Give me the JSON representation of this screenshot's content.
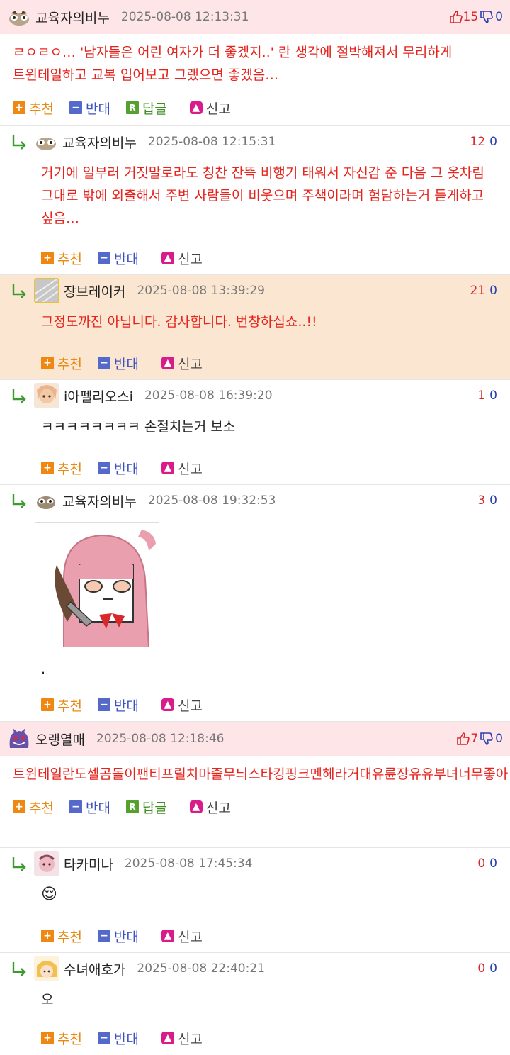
{
  "labels": {
    "recommend": "추천",
    "oppose": "반대",
    "reply": "답글",
    "report": "신고"
  },
  "colors": {
    "highlight_row": "#fbe6d2",
    "top_header": "#fde5e8",
    "up": "#d7262c",
    "down": "#2a3fb0"
  },
  "comments": [
    {
      "nick": "교육자의비누",
      "date": "2025-08-08 12:13:31",
      "up": "15",
      "down": "0",
      "text": "ㄹㅇㄹㅇ… '남자들은 어린 여자가 더 좋겠지..' 란 생각에 절박해져서 무리하게 트윈테일하고 교복 입어보고 그랬으면 좋겠음…",
      "replies": [
        {
          "nick": "교육자의비누",
          "date": "2025-08-08 12:15:31",
          "up": "12",
          "down": "0",
          "text": "거기에 일부러 거짓말로라도 칭찬 잔뜩 비행기 태워서 자신감 준 다음 그 옷차림 그대로 밖에 외출해서 주변 사람들이 비웃으며 주책이라며 험담하는거 듣게하고 싶음…"
        },
        {
          "nick": "장브레이커",
          "date": "2025-08-08 13:39:29",
          "up": "21",
          "down": "0",
          "text": "그정도까진 아닙니다. 감사합니다. 번창하십쇼..!!"
        },
        {
          "nick": "i아펠리오스i",
          "date": "2025-08-08 16:39:20",
          "up": "1",
          "down": "0",
          "text": "ㅋㅋㅋㅋㅋㅋㅋㅋ 손절치는거 보소"
        },
        {
          "nick": "교육자의비누",
          "date": "2025-08-08 19:32:53",
          "up": "3",
          "down": "0",
          "text": "."
        }
      ]
    },
    {
      "nick": "오랭열매",
      "date": "2025-08-08 12:18:46",
      "up": "7",
      "down": "0",
      "text": "트윈테일란도셀곰돌이팬티프릴치마줄무늬스타킹핑크멘헤라거대유륜장유유부녀너무좋아",
      "replies": [
        {
          "nick": "타카미나",
          "date": "2025-08-08 17:45:34",
          "up": "0",
          "down": "0",
          "text": "😌"
        },
        {
          "nick": "수녀애호가",
          "date": "2025-08-08 22:40:21",
          "up": "0",
          "down": "0",
          "text": "오"
        }
      ]
    }
  ]
}
